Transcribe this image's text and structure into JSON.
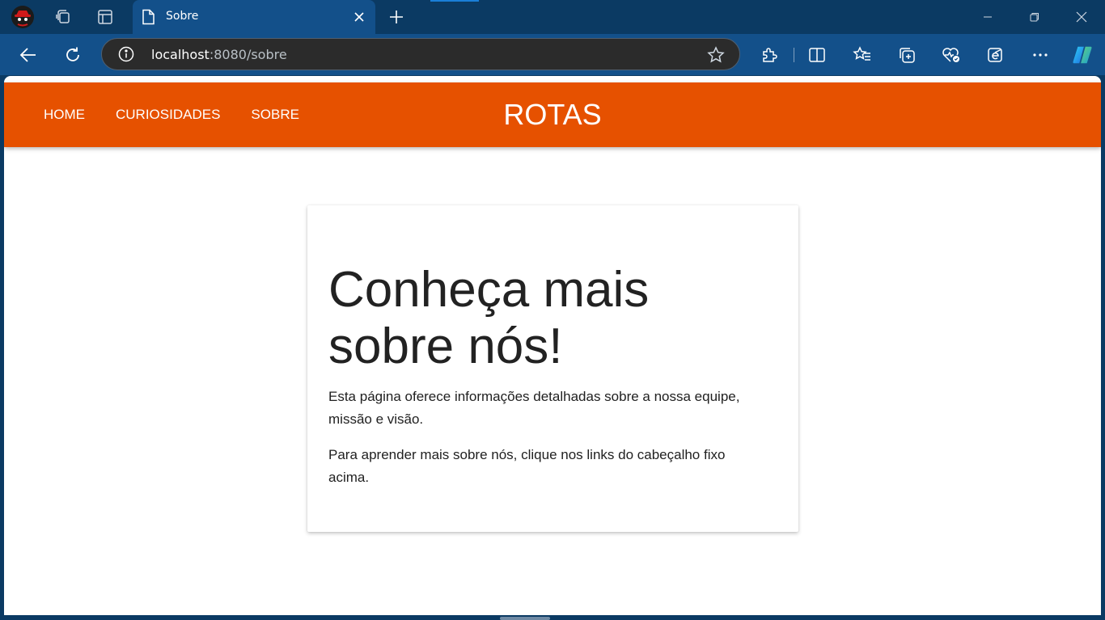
{
  "browser": {
    "tab": {
      "title": "Sobre"
    },
    "address_bar": {
      "host": "localhost",
      "rest": ":8080/sobre"
    },
    "icons": [
      "profile-avatar-icon",
      "workspaces-icon",
      "tab-actions-icon",
      "page-icon",
      "close-icon",
      "new-tab-icon",
      "minimize-icon",
      "restore-icon",
      "window-close-icon",
      "back-icon",
      "refresh-icon",
      "info-icon",
      "favorite-star-icon",
      "extensions-icon",
      "split-screen-icon",
      "favorites-icon",
      "collections-icon",
      "browser-essentials-icon",
      "internet-explorer-mode-icon",
      "more-icon",
      "copilot-icon"
    ],
    "accent_color": "#13508a"
  },
  "site": {
    "header_color": "#e65100",
    "nav": [
      {
        "label": "HOME"
      },
      {
        "label": "CURIOSIDADES"
      },
      {
        "label": "SOBRE"
      }
    ],
    "brand": "ROTAS"
  },
  "content": {
    "heading": "Conheça mais sobre nós!",
    "paragraphs": [
      "Esta página oferece informações detalhadas sobre a nossa equipe, missão e visão.",
      "Para aprender mais sobre nós, clique nos links do cabeçalho fixo acima."
    ]
  }
}
